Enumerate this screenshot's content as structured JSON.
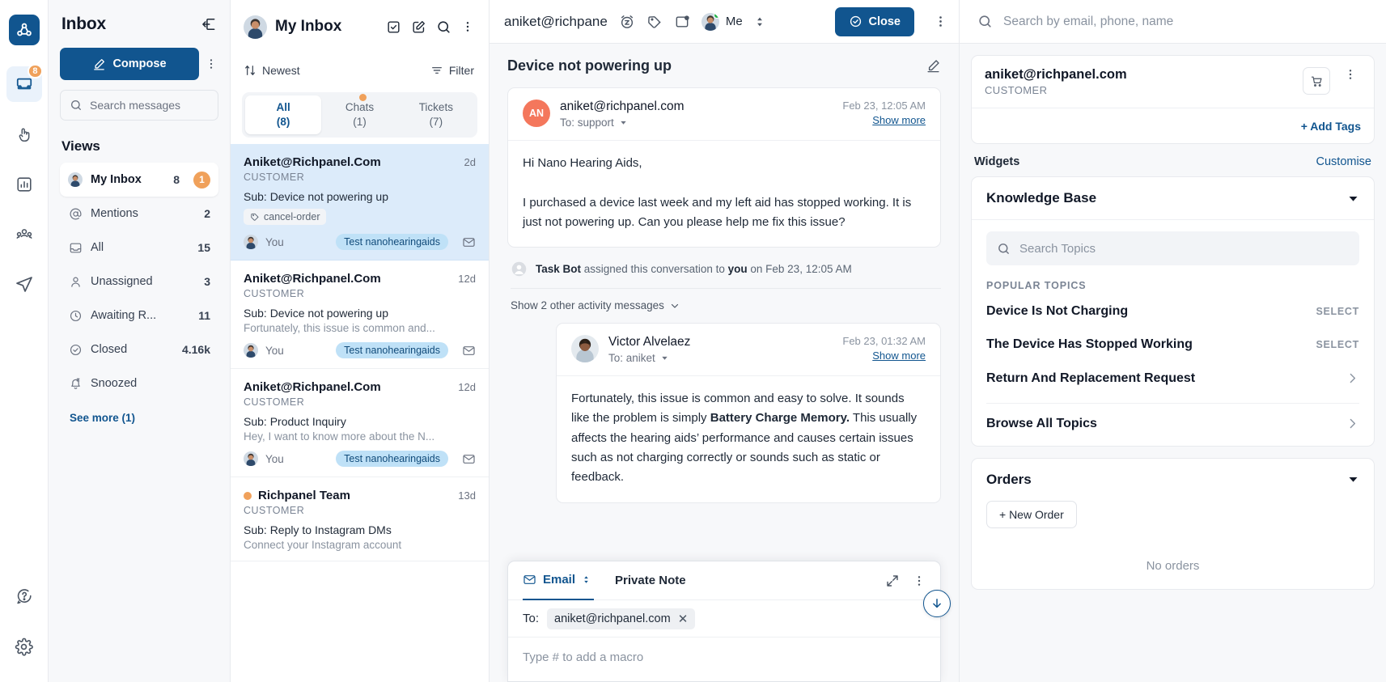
{
  "rail": {
    "logo_icon": "richpanel-logo-icon",
    "items": [
      {
        "icon": "inbox-icon",
        "badge": "8",
        "active": true
      },
      {
        "icon": "hand-pointer-icon",
        "badge": "",
        "active": false
      },
      {
        "icon": "bar-chart-icon",
        "badge": "",
        "active": false
      },
      {
        "icon": "team-icon",
        "badge": "",
        "active": false
      },
      {
        "icon": "send-icon",
        "badge": "",
        "active": false
      }
    ],
    "bottom": [
      {
        "icon": "help-circle-icon"
      },
      {
        "icon": "gear-icon"
      }
    ]
  },
  "sidebar": {
    "title": "Inbox",
    "collapse_icon": "panel-collapse-icon",
    "compose_label": "Compose",
    "compose_icon": "compose-icon",
    "kebab_icon": "more-vertical-icon",
    "search_placeholder": "Search messages",
    "search_icon": "search-icon",
    "views_label": "Views",
    "views": [
      {
        "label": "My Inbox",
        "icon": "avatar-icon",
        "count": "8",
        "pill": "1",
        "active": true
      },
      {
        "label": "Mentions",
        "icon": "at-icon",
        "count": "2",
        "pill": "",
        "active": false
      },
      {
        "label": "All",
        "icon": "inbox-tray-icon",
        "count": "15",
        "pill": "",
        "active": false
      },
      {
        "label": "Unassigned",
        "icon": "user-icon",
        "count": "3",
        "pill": "",
        "active": false
      },
      {
        "label": "Awaiting R...",
        "icon": "clock-icon",
        "count": "11",
        "pill": "",
        "active": false
      },
      {
        "label": "Closed",
        "icon": "check-circle-icon",
        "count": "4.16k",
        "pill": "",
        "active": false
      },
      {
        "label": "Snoozed",
        "icon": "snooze-bell-icon",
        "count": "",
        "pill": "",
        "active": false
      }
    ],
    "see_more_label": "See more (1)"
  },
  "convlist": {
    "header_title": "My Inbox",
    "header_icons": [
      "select-all-icon",
      "compose-icon",
      "search-icon",
      "more-vertical-icon"
    ],
    "sort_label": "Newest",
    "sort_icon": "sort-icon",
    "filter_label": "Filter",
    "filter_icon": "filter-icon",
    "tabs": [
      {
        "label": "All",
        "count": "(8)",
        "active": true,
        "dot": false
      },
      {
        "label": "Chats",
        "count": "(1)",
        "active": false,
        "dot": true
      },
      {
        "label": "Tickets",
        "count": "(7)",
        "active": false,
        "dot": false
      }
    ],
    "items": [
      {
        "name": "Aniket@Richpanel.Com",
        "time": "2d",
        "role": "CUSTOMER",
        "subject": "Sub: Device not powering up",
        "snippet": "",
        "tag": "cancel-order",
        "tag_icon": "tag-icon",
        "who": "You",
        "chip": "Test nanohearingaids",
        "channel_icon": "mail-icon",
        "selected": true,
        "unread": false
      },
      {
        "name": "Aniket@Richpanel.Com",
        "time": "12d",
        "role": "CUSTOMER",
        "subject": "Sub: Device not powering up",
        "snippet": "Fortunately, this issue is common and...",
        "tag": "",
        "tag_icon": "",
        "who": "You",
        "chip": "Test nanohearingaids",
        "channel_icon": "mail-icon",
        "selected": false,
        "unread": false
      },
      {
        "name": "Aniket@Richpanel.Com",
        "time": "12d",
        "role": "CUSTOMER",
        "subject": "Sub: Product Inquiry",
        "snippet": "Hey, I want to know more about the N...",
        "tag": "",
        "tag_icon": "",
        "who": "You",
        "chip": "Test nanohearingaids",
        "channel_icon": "mail-icon",
        "selected": false,
        "unread": false
      },
      {
        "name": "Richpanel Team",
        "time": "13d",
        "role": "CUSTOMER",
        "subject": "Sub: Reply to Instagram DMs",
        "snippet": "Connect your Instagram account",
        "tag": "",
        "tag_icon": "",
        "who": "",
        "chip": "",
        "channel_icon": "instagram-icon",
        "selected": false,
        "unread": true
      }
    ]
  },
  "main": {
    "header": {
      "email": "aniket@richpane",
      "icons": [
        "snooze-icon",
        "tag-icon",
        "archive-icon"
      ],
      "assignee_label": "Me",
      "assignee_avatar_icon": "avatar-icon",
      "swap_icon": "up-down-icon",
      "close_label": "Close",
      "close_icon": "check-circle-icon",
      "kebab_icon": "more-vertical-icon"
    },
    "subject": "Device not powering up",
    "edit_icon": "pencil-icon",
    "messages": [
      {
        "avatar_initials": "AN",
        "avatar_color": "#f4775c",
        "from": "aniket@richpanel.com",
        "to": "To: support",
        "date": "Feb 23, 12:05 AM",
        "show_more": "Show more",
        "body": "Hi Nano Hearing Aids,\n\nI purchased a device last week and my left aid has stopped working. It is just not powering up. Can you please help me fix this issue?"
      },
      {
        "avatar_initials": "",
        "avatar_color": "#d9e3ee",
        "from": "Victor Alvelaez",
        "to": "To: aniket",
        "date": "Feb 23, 01:32 AM",
        "show_more": "Show more",
        "body_pre": "Fortunately, this issue is common and easy to solve. It sounds like the problem is simply ",
        "body_bold": "Battery Charge Memory.",
        "body_post": " This usually affects the hearing aids’ performance and causes certain issues such as not charging correctly or sounds such as static or feedback."
      }
    ],
    "activity": {
      "actor": "Task Bot",
      "text_mid": " assigned this conversation to ",
      "target": "you",
      "text_end": " on Feb 23, 12:05 AM",
      "icon": "user-circle-icon"
    },
    "show_activity_label": "Show 2 other activity messages",
    "scroll_down_icon": "arrow-down-circle-icon",
    "composer": {
      "tab_email": "Email",
      "tab_email_icon": "mail-icon",
      "tab_email_caret": "up-down-icon",
      "tab_note": "Private Note",
      "expand_icon": "expand-icon",
      "kebab_icon": "more-vertical-icon",
      "to_label": "To:",
      "to_chip": "aniket@richpanel.com",
      "remove_icon": "close-icon",
      "placeholder": "Type # to add a macro"
    }
  },
  "right": {
    "search_placeholder": "Search by email, phone, name",
    "search_icon": "search-icon",
    "customer": {
      "name": "aniket@richpanel.com",
      "role": "CUSTOMER",
      "cart_icon": "cart-icon",
      "kebab_icon": "more-vertical-icon",
      "add_tags_label": "+ Add Tags"
    },
    "widgets_label": "Widgets",
    "customise_label": "Customise",
    "knowledge_base": {
      "title": "Knowledge Base",
      "caret_icon": "caret-down-icon",
      "search_placeholder": "Search Topics",
      "search_icon": "search-icon",
      "popular_label": "POPULAR TOPICS",
      "topics": [
        {
          "title": "Device Is Not Charging",
          "action": "SELECT",
          "chevron": false
        },
        {
          "title": "The Device Has Stopped Working",
          "action": "SELECT",
          "chevron": false
        },
        {
          "title": "Return And Replacement Request",
          "action": "",
          "chevron": true
        }
      ],
      "browse_label": "Browse All Topics",
      "browse_chevron_icon": "chevron-right-icon"
    },
    "orders": {
      "title": "Orders",
      "caret_icon": "caret-down-icon",
      "new_order_label": "+ New Order",
      "empty_label": "No orders"
    }
  }
}
